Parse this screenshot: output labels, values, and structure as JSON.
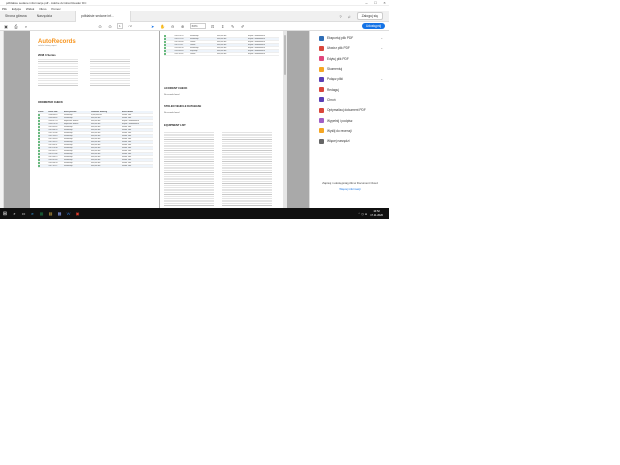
{
  "window": {
    "title": "pdfdalsie sedane informacje.pdf - Adobe Acrobat Reader DC"
  },
  "menu": [
    "Plik",
    "Edycja",
    "Widok",
    "Okno",
    "Pomoc"
  ],
  "tabs": {
    "home": "Strona główna",
    "tools": "Narzędzia",
    "doc": "pdfdalsie sedane inf..."
  },
  "header": {
    "signin": "Zaloguj się",
    "share": "Udostępnij"
  },
  "toolbar": {
    "page_current": "1",
    "page_total": "/ 2",
    "zoom": "66%"
  },
  "right_tools": [
    {
      "label": "Eksportuj plik PDF",
      "icon": "export-pdf-icon",
      "color": "#2f6db5",
      "chev": "⌄"
    },
    {
      "label": "Utwórz plik PDF",
      "icon": "create-pdf-icon",
      "color": "#d9463b",
      "chev": "⌄"
    },
    {
      "label": "Edytuj plik PDF",
      "icon": "edit-pdf-icon",
      "color": "#e0457b",
      "chev": ""
    },
    {
      "label": "Skomentuj",
      "icon": "comment-icon",
      "color": "#f5a623",
      "chev": ""
    },
    {
      "label": "Połącz pliki",
      "icon": "combine-files-icon",
      "color": "#5a3fb5",
      "chev": "⌄"
    },
    {
      "label": "Redaguj",
      "icon": "redact-icon",
      "color": "#d9463b",
      "chev": ""
    },
    {
      "label": "Chroń",
      "icon": "protect-icon",
      "color": "#5a3fb5",
      "chev": ""
    },
    {
      "label": "Optymalizuj dokument PDF",
      "icon": "optimize-icon",
      "color": "#d9463b",
      "chev": ""
    },
    {
      "label": "Wypełnij i podpisz",
      "icon": "fill-sign-icon",
      "color": "#a05fc6",
      "chev": ""
    },
    {
      "label": "Wyślij do recenzji",
      "icon": "send-review-icon",
      "color": "#f5a623",
      "chev": ""
    },
    {
      "label": "Więcej narzędzi",
      "icon": "more-tools-icon",
      "color": "#666666",
      "chev": ""
    }
  ],
  "promo": {
    "text": "Zapisuj i udostępniaj pliki w Document Cloud",
    "learn": "Więcej informacji"
  },
  "page1": {
    "logo_a": "Auto",
    "logo_b": "Records",
    "tagline": "vehicle history report",
    "car": "2008 3 Series",
    "odometer_title": "ODOMETER CHECK",
    "cols": [
      "Status",
      "Event date",
      "Event provider",
      "Odometer Reading",
      "Event details"
    ],
    "rows": [
      [
        "",
        "2008-06-01",
        "Dealership",
        "0,000,000 km",
        "Dealer Visit"
      ],
      [
        "",
        "2009-04-02",
        "Dealership",
        "000,000 km",
        "Dealer Visit"
      ],
      [
        "",
        "2009-07-13",
        "Inspection Station",
        "000,000 km",
        "Repair / Maintenance"
      ],
      [
        "",
        "2009-10-14",
        "Inspection Station",
        "000,000 km",
        "Repair / Maintenance"
      ],
      [
        "",
        "2010-03-02",
        "Dealership",
        "000,000 km",
        "Dealer Visit"
      ],
      [
        "",
        "2010-08-19",
        "Dealership",
        "000,000 km",
        "Dealer Visit"
      ],
      [
        "",
        "2011-02-08",
        "Dealership",
        "000,000 km",
        "Dealer Visit"
      ],
      [
        "",
        "2011-09-10",
        "Dealership",
        "000,000 km",
        "Dealer Visit"
      ],
      [
        "",
        "2012-03-05",
        "Dealership",
        "000,000 km",
        "Dealer Visit"
      ],
      [
        "",
        "2012-09-22",
        "Dealership",
        "000,000 km",
        "Dealer Visit"
      ],
      [
        "",
        "2013-04-11",
        "Dealership",
        "000,000 km",
        "Dealer Visit"
      ],
      [
        "",
        "2013-10-30",
        "Dealership",
        "000,000 km",
        "Dealer Visit"
      ],
      [
        "",
        "2014-05-17",
        "Dealership",
        "000,000 km",
        "Dealer Visit"
      ],
      [
        "",
        "2014-11-06",
        "Dealership",
        "000,000 km",
        "Dealer Visit"
      ],
      [
        "",
        "2015-06-21",
        "Dealership",
        "000,000 km",
        "Dealer Visit"
      ],
      [
        "",
        "2016-01-09",
        "Dealership",
        "000,000 km",
        "Dealer Visit"
      ],
      [
        "",
        "2016-08-14",
        "Dealership",
        "000,000 km",
        "Dealer Visit"
      ],
      [
        "",
        "2017-02-27",
        "Dealership",
        "000,000 km",
        "Dealer Visit"
      ]
    ]
  },
  "page2": {
    "rows": [
      [
        "",
        "2018-10-15",
        "Dealership",
        "000,000 km",
        "Repair / Maintenance"
      ],
      [
        "",
        "2018-12-20",
        "Dealership",
        "000,000 km",
        "Repair / Maintenance"
      ],
      [
        "",
        "2019-05-04",
        "Lenein",
        "000,000 km",
        "Repair / Maintenance"
      ],
      [
        "",
        "2019-11-11",
        "Lenein",
        "000,000 km",
        "Repair / Maintenance"
      ],
      [
        "",
        "2020-03-18",
        "Dealership",
        "000,000 km",
        "Repair / Maintenance"
      ],
      [
        "",
        "2020-09-05",
        "DropShip",
        "000,000 km",
        "Repair / Maintenance"
      ],
      [
        "",
        "2021-02-02",
        "Lenein",
        "000,000 km",
        "Repair / Maintenance"
      ]
    ],
    "accident_title": "ACCIDENT CHECK",
    "accident_text": "No records found",
    "stolen_title": "STOLEN VEHICLE DATABASE",
    "stolen_text": "No records found",
    "equipment_title": "EQUIPMENT LIST"
  },
  "taskbar": {
    "time": "10:52",
    "date": "17.11.2020"
  }
}
